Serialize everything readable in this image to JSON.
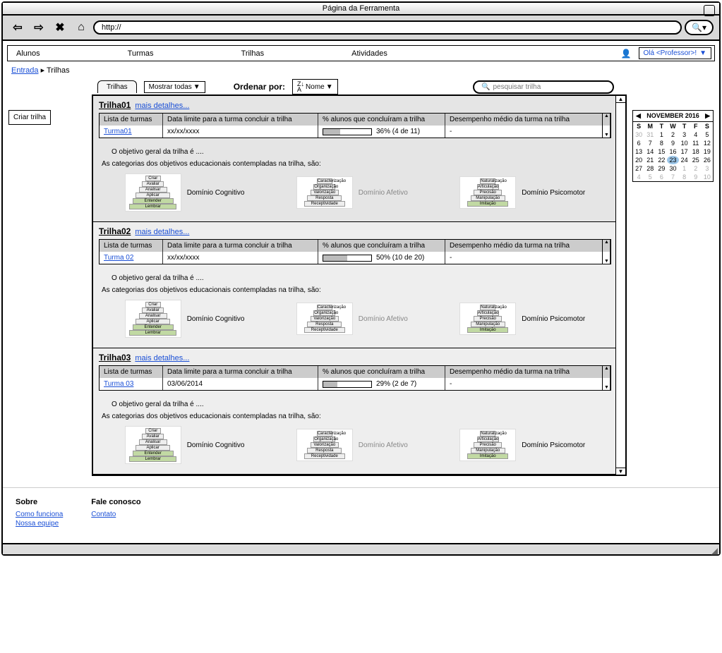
{
  "browser": {
    "title": "Página da Ferramenta",
    "url": "http://"
  },
  "nav": {
    "items": [
      "Alunos",
      "Turmas",
      "Trilhas",
      "Atividades"
    ],
    "user_greeting": "Olá <Professor>!"
  },
  "breadcrumb": {
    "entrada": "Entrada",
    "current": "Trilhas"
  },
  "sidebar": {
    "create_label": "Criar trilha"
  },
  "tabs": {
    "trilhas": "Trilhas",
    "filter": "Mostrar todas",
    "sort_label": "Ordenar por:",
    "sort_value": "Nome",
    "search_placeholder": "pesquisar trilha"
  },
  "table_headers": {
    "c1": "Lista de turmas",
    "c2": "Data limite para a turma concluir a trilha",
    "c3": "% alunos que concluíram a trilha",
    "c4": "Desempenho médio da turma na trilha"
  },
  "common": {
    "objetivo": "O objetivo geral da trilha é ....",
    "categorias": "As categorias dos objetivos educacionais contempladas na trilha, são:",
    "mais_detalhes": "mais detalhes...",
    "dominio_cognitivo": "Domínio Cognitivo",
    "dominio_afetivo": "Domínio Afetivo",
    "dominio_psicomotor": "Domínio Psicomotor"
  },
  "pyramids": {
    "cognitivo": [
      "Criar",
      "Avaliar",
      "Analisar",
      "Aplicar",
      "Entender",
      "Lembrar"
    ],
    "afetivo": [
      "Caracterização",
      "Organização",
      "Valorização",
      "Resposta",
      "Receptividade"
    ],
    "psicomotor": [
      "Naturalização",
      "Articulação",
      "Precisão",
      "Manipulação",
      "Imitação"
    ]
  },
  "trilhas": [
    {
      "name": "Trilha01",
      "turma": "Turma01",
      "deadline": "xx/xx/xxxx",
      "progress_pct": 36,
      "progress_text": "36% (4 de 11)",
      "desempenho": "-",
      "cognitivo_hl": [
        4,
        5
      ],
      "afetivo_hl": [],
      "psicomotor_hl": [
        4
      ]
    },
    {
      "name": "Trilha02",
      "turma": "Turma 02",
      "deadline": "xx/xx/xxxx",
      "progress_pct": 50,
      "progress_text": "50% (10 de 20)",
      "desempenho": "-",
      "cognitivo_hl": [
        4,
        5
      ],
      "afetivo_hl": [],
      "psicomotor_hl": [
        4
      ]
    },
    {
      "name": "Trilha03",
      "turma": "Turma 03",
      "deadline": "03/06/2014",
      "progress_pct": 29,
      "progress_text": "29% (2 de 7)",
      "desempenho": "-",
      "cognitivo_hl": [
        4,
        5
      ],
      "afetivo_hl": [],
      "psicomotor_hl": [
        4
      ]
    }
  ],
  "calendar": {
    "title": "NOVEMBER 2016",
    "dow": [
      "S",
      "M",
      "T",
      "W",
      "T",
      "F",
      "S"
    ],
    "leading": [
      30,
      31
    ],
    "days": [
      1,
      2,
      3,
      4,
      5,
      6,
      7,
      8,
      9,
      10,
      11,
      12,
      13,
      14,
      15,
      16,
      17,
      18,
      19,
      20,
      21,
      22,
      23,
      24,
      25,
      26,
      27,
      28,
      29,
      30
    ],
    "trailing": [
      1,
      2,
      3,
      4,
      5,
      6,
      7,
      8,
      9,
      10
    ],
    "today": 23
  },
  "footer": {
    "sobre": "Sobre",
    "como_funciona": "Como funciona",
    "nossa_equipe": "Nossa equipe",
    "fale_conosco": "Fale conosco",
    "contato": "Contato"
  }
}
